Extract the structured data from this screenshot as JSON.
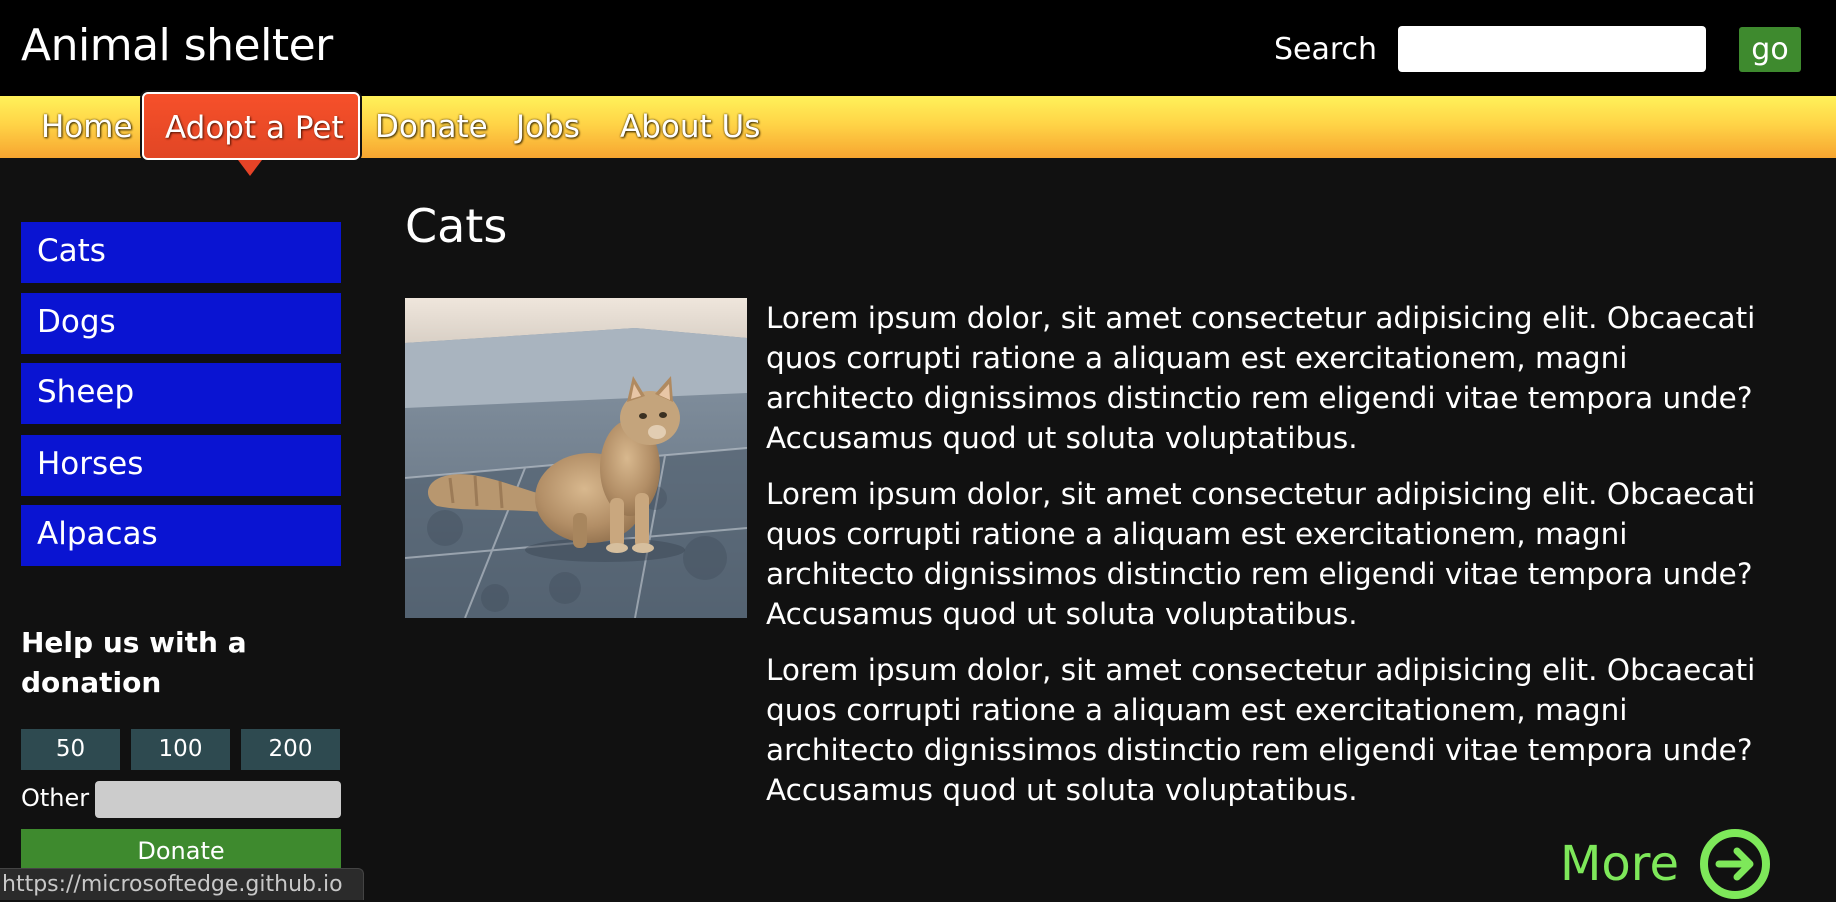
{
  "header": {
    "site_title": "Animal shelter",
    "search_label": "Search",
    "search_value": "",
    "go_label": "go"
  },
  "nav": {
    "items": [
      {
        "label": "Home"
      },
      {
        "label": "Adopt a Pet",
        "active": true
      },
      {
        "label": "Donate"
      },
      {
        "label": "Jobs"
      },
      {
        "label": "About Us"
      }
    ]
  },
  "sidebar": {
    "categories": [
      {
        "label": "Cats"
      },
      {
        "label": "Dogs"
      },
      {
        "label": "Sheep"
      },
      {
        "label": "Horses"
      },
      {
        "label": "Alpacas"
      }
    ],
    "donation": {
      "heading": "Help us with a donation",
      "amounts": [
        "50",
        "100",
        "200"
      ],
      "other_label": "Other",
      "other_value": "",
      "donate_label": "Donate"
    }
  },
  "main": {
    "heading": "Cats",
    "image_icon": "cat-photo",
    "paragraphs": [
      "Lorem ipsum dolor, sit amet consectetur adipisicing elit. Obcaecati quos corrupti ratione a aliquam est exercitationem, magni architecto dignissimos distinctio rem eligendi vitae tempora unde? Accusamus quod ut soluta voluptatibus.",
      "Lorem ipsum dolor, sit amet consectetur adipisicing elit. Obcaecati quos corrupti ratione a aliquam est exercitationem, magni architecto dignissimos distinctio rem eligendi vitae tempora unde? Accusamus quod ut soluta voluptatibus.",
      "Lorem ipsum dolor, sit amet consectetur adipisicing elit. Obcaecati quos corrupti ratione a aliquam est exercitationem, magni architecto dignissimos distinctio rem eligendi vitae tempora unde? Accusamus quod ut soluta voluptatibus."
    ],
    "more_label": "More",
    "more_icon": "arrow-circle-right-icon"
  },
  "status_bar": {
    "url": "https://microsoftedge.github.io"
  },
  "colors": {
    "header_bg": "#000000",
    "nav_gradient_top": "#fff25a",
    "nav_gradient_bottom": "#f7a530",
    "nav_active": "#e54327",
    "category_bg": "#0a14d2",
    "amount_bg": "#2e4a50",
    "accent_green": "#3e8a2e",
    "more_green": "#7ee85a",
    "page_bg": "#111111"
  }
}
